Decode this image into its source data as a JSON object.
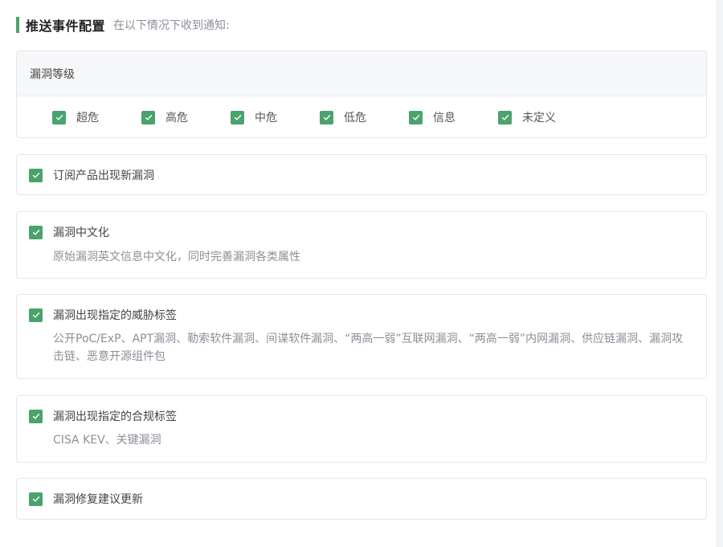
{
  "header": {
    "title": "推送事件配置",
    "subtitle": "在以下情况下收到通知:"
  },
  "vuln_level": {
    "label": "漏洞等级",
    "options": [
      {
        "label": "超危",
        "checked": true
      },
      {
        "label": "高危",
        "checked": true
      },
      {
        "label": "中危",
        "checked": true
      },
      {
        "label": "低危",
        "checked": true
      },
      {
        "label": "信息",
        "checked": true
      },
      {
        "label": "未定义",
        "checked": true
      }
    ]
  },
  "events": [
    {
      "label": "订阅产品出现新漏洞",
      "checked": true,
      "desc": ""
    },
    {
      "label": "漏洞中文化",
      "checked": true,
      "desc": "原始漏洞英文信息中文化，同时完善漏洞各类属性"
    },
    {
      "label": "漏洞出现指定的威胁标签",
      "checked": true,
      "desc": "公开PoC/ExP、APT漏洞、勒索软件漏洞、间谍软件漏洞、“两高一弱”互联网漏洞、“两高一弱”内网漏洞、供应链漏洞、漏洞攻击链、恶意开源组件包"
    },
    {
      "label": "漏洞出现指定的合规标签",
      "checked": true,
      "desc": "CISA KEV、关键漏洞"
    },
    {
      "label": "漏洞修复建议更新",
      "checked": true,
      "desc": ""
    }
  ],
  "colors": {
    "accent": "#4aa36d",
    "checkbox": "#4aa36d",
    "muted_text": "#8a8f98"
  }
}
